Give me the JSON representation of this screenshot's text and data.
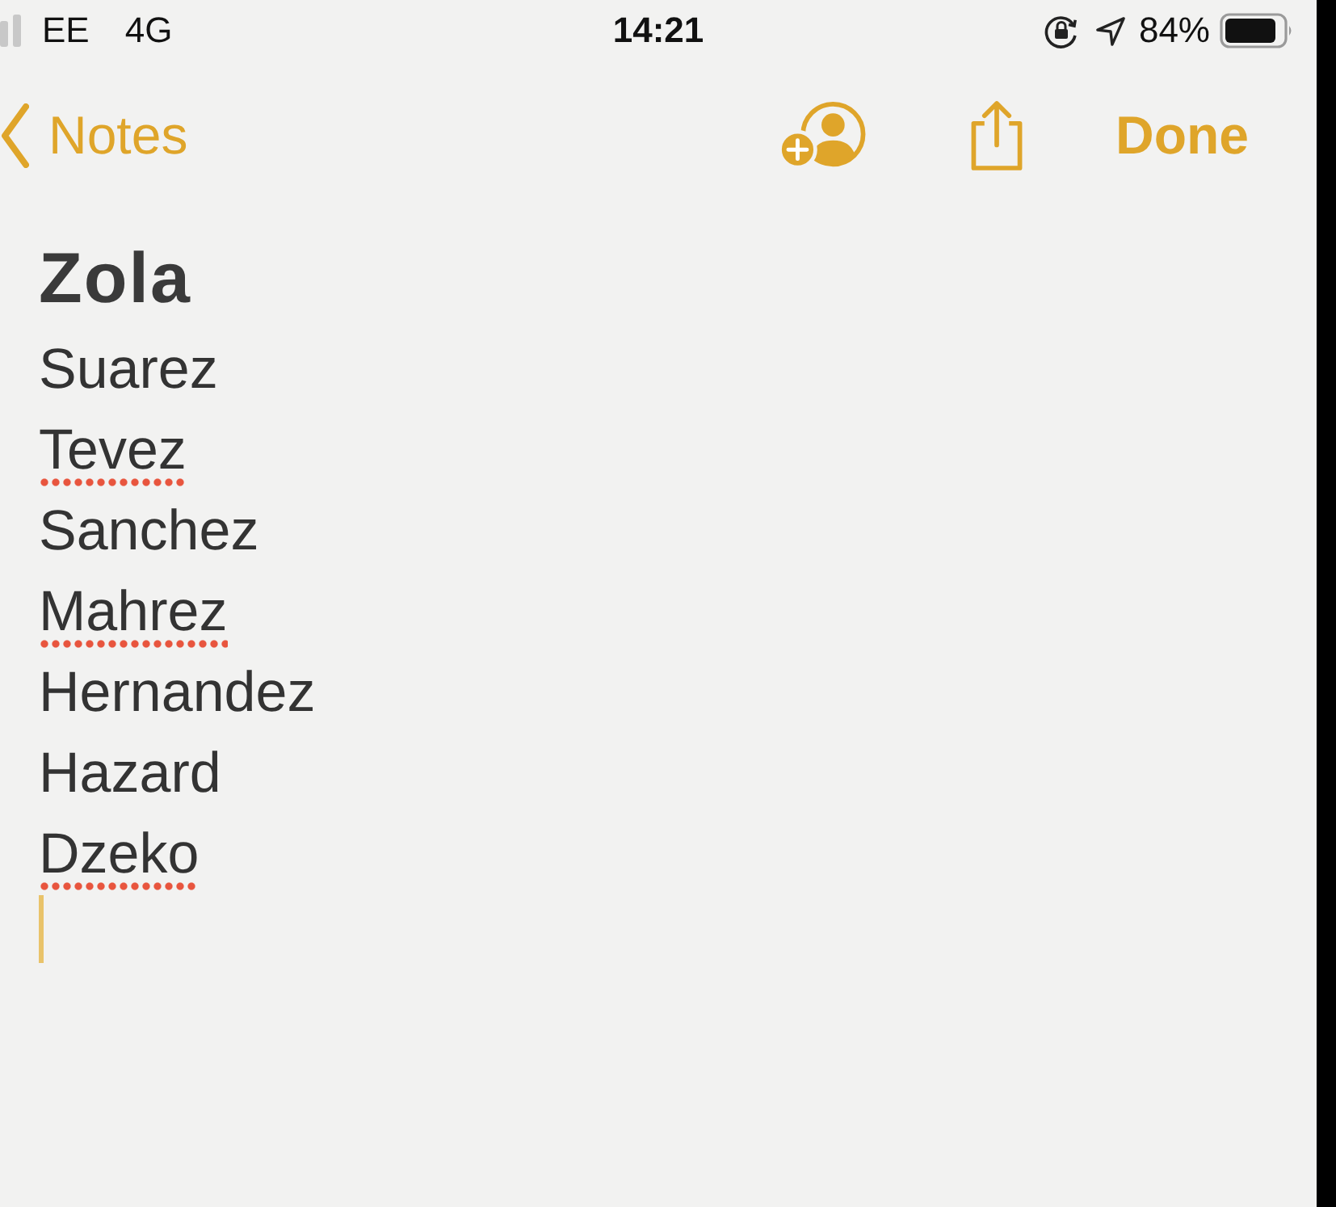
{
  "status_bar": {
    "carrier": "EE",
    "network": "4G",
    "time": "14:21",
    "battery_percent": "84%"
  },
  "nav_bar": {
    "back_label": "Notes",
    "done_label": "Done"
  },
  "note": {
    "title": "Zola",
    "lines": [
      {
        "text": "Suarez",
        "misspelled": false
      },
      {
        "text": "Tevez",
        "misspelled": true
      },
      {
        "text": "Sanchez",
        "misspelled": false
      },
      {
        "text": "Mahrez",
        "misspelled": true
      },
      {
        "text": "Hernandez",
        "misspelled": false
      },
      {
        "text": "Hazard",
        "misspelled": false
      },
      {
        "text": "Dzeko",
        "misspelled": true
      }
    ]
  }
}
